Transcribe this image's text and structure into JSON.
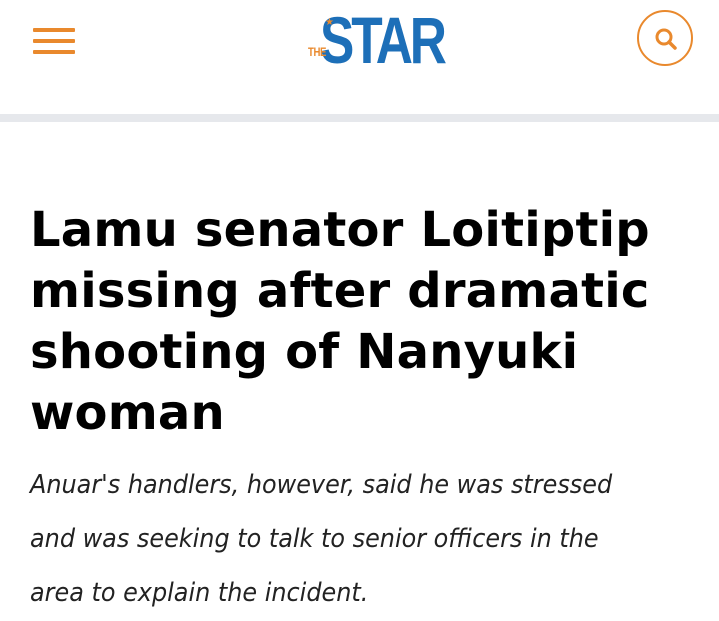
{
  "header": {
    "menu_icon": "hamburger-menu-icon",
    "logo": {
      "prefix": "THE",
      "name": "STAR"
    },
    "search_icon": "search-icon",
    "accent_color": "#e9892d",
    "brand_color": "#1d6fb8"
  },
  "article": {
    "headline": "Lamu senator Loitiptip missing after dramatic shooting of Nanyuki woman",
    "subtitle": "Anuar's handlers, however, said he was stressed and was seeking to talk to senior officers in the area to explain the incident."
  }
}
